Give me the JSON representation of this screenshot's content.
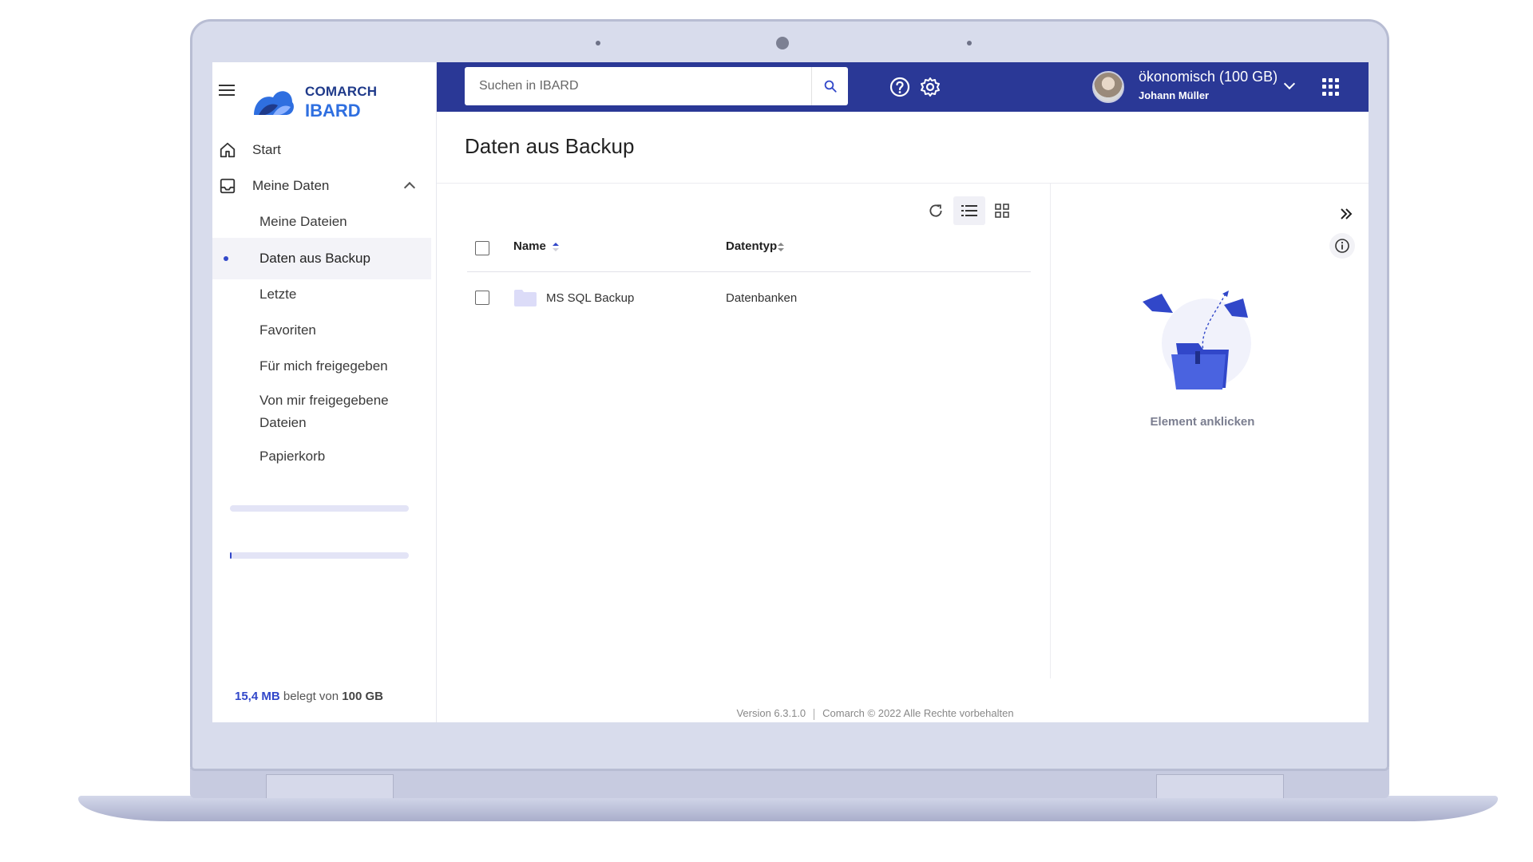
{
  "app": {
    "brand_top": "COMARCH",
    "brand_bottom": "IBARD"
  },
  "search": {
    "placeholder": "Suchen in IBARD"
  },
  "header": {
    "plan": "ökonomisch (100 GB)",
    "user": "Johann Müller"
  },
  "sidebar": {
    "items": [
      {
        "label": "Start",
        "icon": "home-icon"
      },
      {
        "label": "Meine Daten",
        "icon": "inbox-icon"
      }
    ],
    "subitems": [
      {
        "label": "Meine Dateien"
      },
      {
        "label": "Daten aus Backup",
        "active": true
      },
      {
        "label": "Letzte"
      },
      {
        "label": "Favoriten"
      },
      {
        "label": "Für mich freigegeben"
      },
      {
        "label": "Von mir freigegebene Dateien"
      },
      {
        "label": "Papierkorb"
      }
    ],
    "storage": {
      "used": "15,4 MB",
      "middle": " belegt von ",
      "total": "100 GB"
    }
  },
  "main": {
    "title": "Daten aus Backup",
    "columns": {
      "name": "Name",
      "type": "Datentyp"
    },
    "rows": [
      {
        "name": "MS SQL Backup",
        "type": "Datenbanken"
      }
    ]
  },
  "details": {
    "empty_text": "Element anklicken"
  },
  "footer": {
    "version": "Version 6.3.1.0",
    "copyright": "Comarch © 2022 Alle Rechte vorbehalten"
  },
  "colors": {
    "header": "#2a3896",
    "accent": "#3147c9",
    "brand": "#2f6fe0"
  }
}
